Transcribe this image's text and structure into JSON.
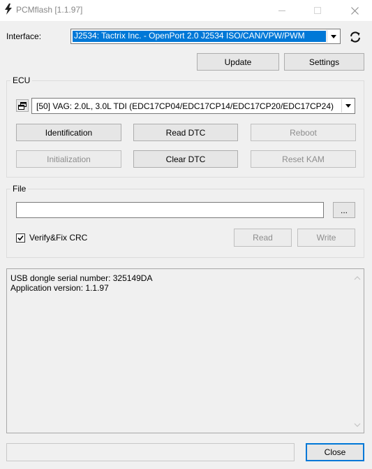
{
  "window": {
    "title": "PCMflash [1.1.97]",
    "icon": "lightning-icon",
    "controls": [
      "minimize-icon",
      "maximize-icon",
      "close-icon"
    ]
  },
  "interface": {
    "label": "Interface:",
    "selected": "J2534: Tactrix Inc. - OpenPort 2.0 J2534 ISO/CAN/VPW/PWM",
    "refresh_icon": "refresh-icon"
  },
  "top_buttons": {
    "update": "Update",
    "settings": "Settings"
  },
  "ecu": {
    "group_label": "ECU",
    "selected": "[50] VAG: 2.0L, 3.0L TDI (EDC17CP04/EDC17CP14/EDC17CP20/EDC17CP24)",
    "buttons": {
      "identification": "Identification",
      "read_dtc": "Read DTC",
      "reboot": "Reboot",
      "initialization": "Initialization",
      "clear_dtc": "Clear DTC",
      "reset_kam": "Reset KAM"
    }
  },
  "file": {
    "group_label": "File",
    "path": "",
    "browse_label": "...",
    "verify_label": "Verify&Fix CRC",
    "verify_checked": true,
    "read_label": "Read",
    "write_label": "Write"
  },
  "log": {
    "lines": [
      "USB dongle serial number: 325149DA",
      "Application version: 1.1.97"
    ]
  },
  "footer": {
    "status_text": "",
    "close_label": "Close"
  }
}
